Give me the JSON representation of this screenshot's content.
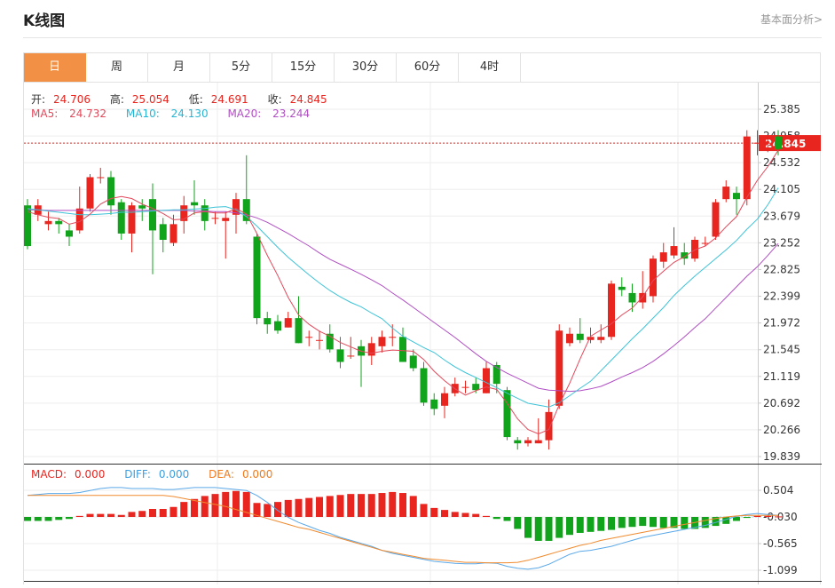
{
  "page": {
    "title": "K线图",
    "link": "基本面分析>"
  },
  "tabs": [
    {
      "label": "日",
      "active": true
    },
    {
      "label": "周",
      "active": false
    },
    {
      "label": "月",
      "active": false
    },
    {
      "label": "5分",
      "active": false
    },
    {
      "label": "15分",
      "active": false
    },
    {
      "label": "30分",
      "active": false
    },
    {
      "label": "60分",
      "active": false
    },
    {
      "label": "4时",
      "active": false
    }
  ],
  "info": {
    "open_label": "开:",
    "open": "24.706",
    "high_label": "高:",
    "high": "25.054",
    "low_label": "低:",
    "low": "24.691",
    "close_label": "收:",
    "close": "24.845",
    "ma5_label": "MA5:",
    "ma5": "24.732",
    "ma10_label": "MA10:",
    "ma10": "24.130",
    "ma20_label": "MA20:",
    "ma20": "23.244",
    "macd_label": "MACD:",
    "macd": "0.000",
    "diff_label": "DIFF:",
    "diff": "0.000",
    "dea_label": "DEA:",
    "dea": "0.000"
  },
  "colors": {
    "up": "#e8251f",
    "down": "#12a31c",
    "ma5": "#e2495b",
    "ma10": "#3dc3d8",
    "ma20": "#b04fc3",
    "diff": "#5aa8e8",
    "dea": "#f08a2e",
    "active_tab": "#f29146"
  },
  "chart_data": {
    "type": "candlestick",
    "price_axis": {
      "ticks": [
        "25.385",
        "24.958",
        "24.532",
        "24.105",
        "23.679",
        "23.252",
        "22.825",
        "22.399",
        "21.972",
        "21.545",
        "21.119",
        "20.692",
        "20.266",
        "19.839"
      ],
      "min": 19.839,
      "max": 25.385
    },
    "current_price": "24.845",
    "macd_axis": {
      "ticks": [
        "0.504",
        "-0.030",
        "-0.565",
        "-1.099"
      ],
      "min": -1.099,
      "max": 0.504
    },
    "candles": [
      [
        23.85,
        23.2,
        23.95,
        23.15
      ],
      [
        23.7,
        23.85,
        23.95,
        23.6
      ],
      [
        23.55,
        23.6,
        23.75,
        23.45
      ],
      [
        23.6,
        23.55,
        23.65,
        23.4
      ],
      [
        23.45,
        23.35,
        23.55,
        23.2
      ],
      [
        23.45,
        23.8,
        24.15,
        23.4
      ],
      [
        23.8,
        24.3,
        24.35,
        23.75
      ],
      [
        24.3,
        24.3,
        24.45,
        24.2
      ],
      [
        24.3,
        23.85,
        24.4,
        23.7
      ],
      [
        23.9,
        23.4,
        23.95,
        23.3
      ],
      [
        23.4,
        23.85,
        23.9,
        23.1
      ],
      [
        23.85,
        23.8,
        23.95,
        23.6
      ],
      [
        23.95,
        23.45,
        24.2,
        22.75
      ],
      [
        23.55,
        23.3,
        23.65,
        23.1
      ],
      [
        23.25,
        23.55,
        23.7,
        23.2
      ],
      [
        23.6,
        23.85,
        24.0,
        23.4
      ],
      [
        23.9,
        23.85,
        24.25,
        23.7
      ],
      [
        23.85,
        23.6,
        23.95,
        23.45
      ],
      [
        23.65,
        23.65,
        23.75,
        23.55
      ],
      [
        23.6,
        23.65,
        23.75,
        23.0
      ],
      [
        23.7,
        23.95,
        24.05,
        23.4
      ],
      [
        23.95,
        23.6,
        24.65,
        23.55
      ],
      [
        23.35,
        22.05,
        23.4,
        21.95
      ],
      [
        22.05,
        21.95,
        22.15,
        21.8
      ],
      [
        22.0,
        21.85,
        22.1,
        21.8
      ],
      [
        21.9,
        22.05,
        22.15,
        21.9
      ],
      [
        22.05,
        21.65,
        22.4,
        21.65
      ],
      [
        21.75,
        21.75,
        21.85,
        21.6
      ],
      [
        21.7,
        21.7,
        21.85,
        21.55
      ],
      [
        21.8,
        21.55,
        21.95,
        21.5
      ],
      [
        21.55,
        21.35,
        21.75,
        21.25
      ],
      [
        21.45,
        21.45,
        21.75,
        21.4
      ],
      [
        21.6,
        21.45,
        21.7,
        20.95
      ],
      [
        21.45,
        21.65,
        21.75,
        21.3
      ],
      [
        21.6,
        21.75,
        21.85,
        21.5
      ],
      [
        21.75,
        21.75,
        21.95,
        21.6
      ],
      [
        21.75,
        21.35,
        21.9,
        21.35
      ],
      [
        21.45,
        21.25,
        21.55,
        21.2
      ],
      [
        21.25,
        20.7,
        21.35,
        20.65
      ],
      [
        20.75,
        20.6,
        20.85,
        20.5
      ],
      [
        20.65,
        20.85,
        20.95,
        20.45
      ],
      [
        20.85,
        21.0,
        21.1,
        20.8
      ],
      [
        20.95,
        20.95,
        21.05,
        20.85
      ],
      [
        21.0,
        20.9,
        21.1,
        20.85
      ],
      [
        20.85,
        21.25,
        21.35,
        20.85
      ],
      [
        21.3,
        21.0,
        21.35,
        20.85
      ],
      [
        20.9,
        20.15,
        20.95,
        20.1
      ],
      [
        20.1,
        20.05,
        20.15,
        19.95
      ],
      [
        20.05,
        20.1,
        20.15,
        20.0
      ],
      [
        20.05,
        20.1,
        20.45,
        20.05
      ],
      [
        20.1,
        20.55,
        20.75,
        19.95
      ],
      [
        20.65,
        21.85,
        21.95,
        20.6
      ],
      [
        21.65,
        21.8,
        21.9,
        21.6
      ],
      [
        21.8,
        21.7,
        22.05,
        21.65
      ],
      [
        21.7,
        21.75,
        21.9,
        21.65
      ],
      [
        21.7,
        21.75,
        21.95,
        21.65
      ],
      [
        21.75,
        22.6,
        22.65,
        21.7
      ],
      [
        22.55,
        22.5,
        22.7,
        22.4
      ],
      [
        22.45,
        22.3,
        22.6,
        22.15
      ],
      [
        22.3,
        22.45,
        22.8,
        22.2
      ],
      [
        22.4,
        23.0,
        23.05,
        22.3
      ],
      [
        22.95,
        23.1,
        23.25,
        22.85
      ],
      [
        23.05,
        23.2,
        23.5,
        23.0
      ],
      [
        23.1,
        23.0,
        23.25,
        22.9
      ],
      [
        23.0,
        23.3,
        23.35,
        22.95
      ],
      [
        23.25,
        23.25,
        23.35,
        23.2
      ],
      [
        23.35,
        23.9,
        23.95,
        23.3
      ],
      [
        23.95,
        24.15,
        24.25,
        23.9
      ],
      [
        24.05,
        23.95,
        24.15,
        23.7
      ],
      [
        23.95,
        24.95,
        25.05,
        23.85
      ],
      [
        24.85,
        24.85,
        25.05,
        24.65
      ],
      [
        24.85,
        24.85,
        24.95,
        24.7
      ],
      [
        24.95,
        24.75,
        25.05,
        24.65
      ]
    ],
    "ma5": [
      23.75,
      23.7,
      23.66,
      23.64,
      23.55,
      23.59,
      23.71,
      23.87,
      23.96,
      23.99,
      23.96,
      23.87,
      23.8,
      23.72,
      23.62,
      23.63,
      23.73,
      23.75,
      23.73,
      23.73,
      23.8,
      23.71,
      23.4,
      23.05,
      22.73,
      22.38,
      22.1,
      21.95,
      21.84,
      21.76,
      21.66,
      21.59,
      21.52,
      21.49,
      21.52,
      21.54,
      21.53,
      21.52,
      21.39,
      21.2,
      21.05,
      20.92,
      20.82,
      20.89,
      20.95,
      20.91,
      20.69,
      20.44,
      20.27,
      20.2,
      20.27,
      20.67,
      21.01,
      21.4,
      21.76,
      21.86,
      21.96,
      22.1,
      22.21,
      22.39,
      22.65,
      22.8,
      22.94,
      23.03,
      23.14,
      23.2,
      23.33,
      23.51,
      23.67,
      23.98,
      24.25,
      24.47,
      24.73
    ],
    "ma10": [
      23.8,
      23.78,
      23.76,
      23.74,
      23.72,
      23.7,
      23.7,
      23.71,
      23.72,
      23.74,
      23.74,
      23.75,
      23.76,
      23.77,
      23.78,
      23.78,
      23.79,
      23.8,
      23.82,
      23.83,
      23.78,
      23.67,
      23.52,
      23.35,
      23.18,
      23.02,
      22.88,
      22.74,
      22.61,
      22.49,
      22.39,
      22.3,
      22.23,
      22.13,
      22.04,
      21.89,
      21.76,
      21.67,
      21.58,
      21.5,
      21.38,
      21.27,
      21.18,
      21.1,
      21.02,
      20.94,
      20.85,
      20.77,
      20.69,
      20.66,
      20.63,
      20.7,
      20.81,
      20.93,
      21.04,
      21.21,
      21.38,
      21.55,
      21.72,
      21.88,
      22.05,
      22.22,
      22.41,
      22.57,
      22.72,
      22.86,
      23.0,
      23.14,
      23.29,
      23.47,
      23.63,
      23.86,
      24.13
    ],
    "ma20": [
      23.78,
      23.78,
      23.77,
      23.77,
      23.77,
      23.77,
      23.77,
      23.77,
      23.77,
      23.77,
      23.77,
      23.77,
      23.77,
      23.77,
      23.77,
      23.77,
      23.76,
      23.76,
      23.75,
      23.75,
      23.73,
      23.7,
      23.65,
      23.58,
      23.49,
      23.4,
      23.3,
      23.2,
      23.09,
      22.99,
      22.91,
      22.83,
      22.75,
      22.66,
      22.57,
      22.45,
      22.34,
      22.22,
      22.1,
      21.98,
      21.86,
      21.74,
      21.61,
      21.48,
      21.36,
      21.26,
      21.17,
      21.09,
      21.01,
      20.93,
      20.9,
      20.89,
      20.88,
      20.89,
      20.92,
      20.96,
      21.03,
      21.11,
      21.18,
      21.26,
      21.36,
      21.48,
      21.61,
      21.75,
      21.9,
      22.04,
      22.21,
      22.38,
      22.55,
      22.72,
      22.87,
      23.05,
      23.24
    ],
    "macd_hist": [
      -0.08,
      -0.08,
      -0.08,
      -0.06,
      -0.04,
      0.02,
      0.06,
      0.06,
      0.06,
      0.04,
      0.1,
      0.12,
      0.16,
      0.16,
      0.2,
      0.3,
      0.36,
      0.42,
      0.46,
      0.5,
      0.52,
      0.5,
      0.28,
      0.26,
      0.3,
      0.34,
      0.36,
      0.38,
      0.4,
      0.42,
      0.44,
      0.46,
      0.46,
      0.46,
      0.48,
      0.5,
      0.48,
      0.42,
      0.26,
      0.18,
      0.14,
      0.1,
      0.08,
      0.06,
      0.02,
      -0.04,
      -0.08,
      -0.24,
      -0.42,
      -0.48,
      -0.48,
      -0.42,
      -0.36,
      -0.32,
      -0.3,
      -0.28,
      -0.26,
      -0.22,
      -0.2,
      -0.18,
      -0.2,
      -0.22,
      -0.22,
      -0.24,
      -0.24,
      -0.22,
      -0.18,
      -0.14,
      -0.08,
      -0.02,
      0.02,
      0.02,
      0.01
    ],
    "diff": [
      0.4,
      0.42,
      0.44,
      0.44,
      0.44,
      0.46,
      0.5,
      0.54,
      0.56,
      0.56,
      0.54,
      0.54,
      0.54,
      0.52,
      0.52,
      0.54,
      0.56,
      0.56,
      0.56,
      0.54,
      0.52,
      0.5,
      0.4,
      0.26,
      0.1,
      -0.04,
      -0.14,
      -0.22,
      -0.3,
      -0.36,
      -0.44,
      -0.5,
      -0.56,
      -0.62,
      -0.7,
      -0.76,
      -0.8,
      -0.84,
      -0.88,
      -0.92,
      -0.94,
      -0.96,
      -0.97,
      -0.97,
      -0.95,
      -0.96,
      -1.02,
      -1.06,
      -1.08,
      -1.05,
      -0.98,
      -0.88,
      -0.78,
      -0.72,
      -0.7,
      -0.66,
      -0.62,
      -0.56,
      -0.5,
      -0.44,
      -0.4,
      -0.36,
      -0.32,
      -0.28,
      -0.24,
      -0.2,
      -0.14,
      -0.08,
      -0.02,
      0.02,
      0.04,
      0.02,
      0.0
    ],
    "dea": [
      0.4,
      0.4,
      0.4,
      0.4,
      0.4,
      0.4,
      0.4,
      0.4,
      0.4,
      0.4,
      0.4,
      0.4,
      0.4,
      0.4,
      0.38,
      0.34,
      0.3,
      0.26,
      0.22,
      0.18,
      0.12,
      0.06,
      0.0,
      -0.06,
      -0.12,
      -0.18,
      -0.24,
      -0.28,
      -0.34,
      -0.4,
      -0.46,
      -0.52,
      -0.58,
      -0.64,
      -0.7,
      -0.74,
      -0.78,
      -0.82,
      -0.86,
      -0.88,
      -0.9,
      -0.92,
      -0.94,
      -0.94,
      -0.95,
      -0.95,
      -0.95,
      -0.94,
      -0.9,
      -0.84,
      -0.78,
      -0.72,
      -0.66,
      -0.6,
      -0.56,
      -0.5,
      -0.46,
      -0.42,
      -0.38,
      -0.34,
      -0.3,
      -0.26,
      -0.22,
      -0.18,
      -0.14,
      -0.1,
      -0.06,
      -0.03,
      -0.01,
      0.0,
      0.0,
      0.0,
      0.0
    ]
  }
}
